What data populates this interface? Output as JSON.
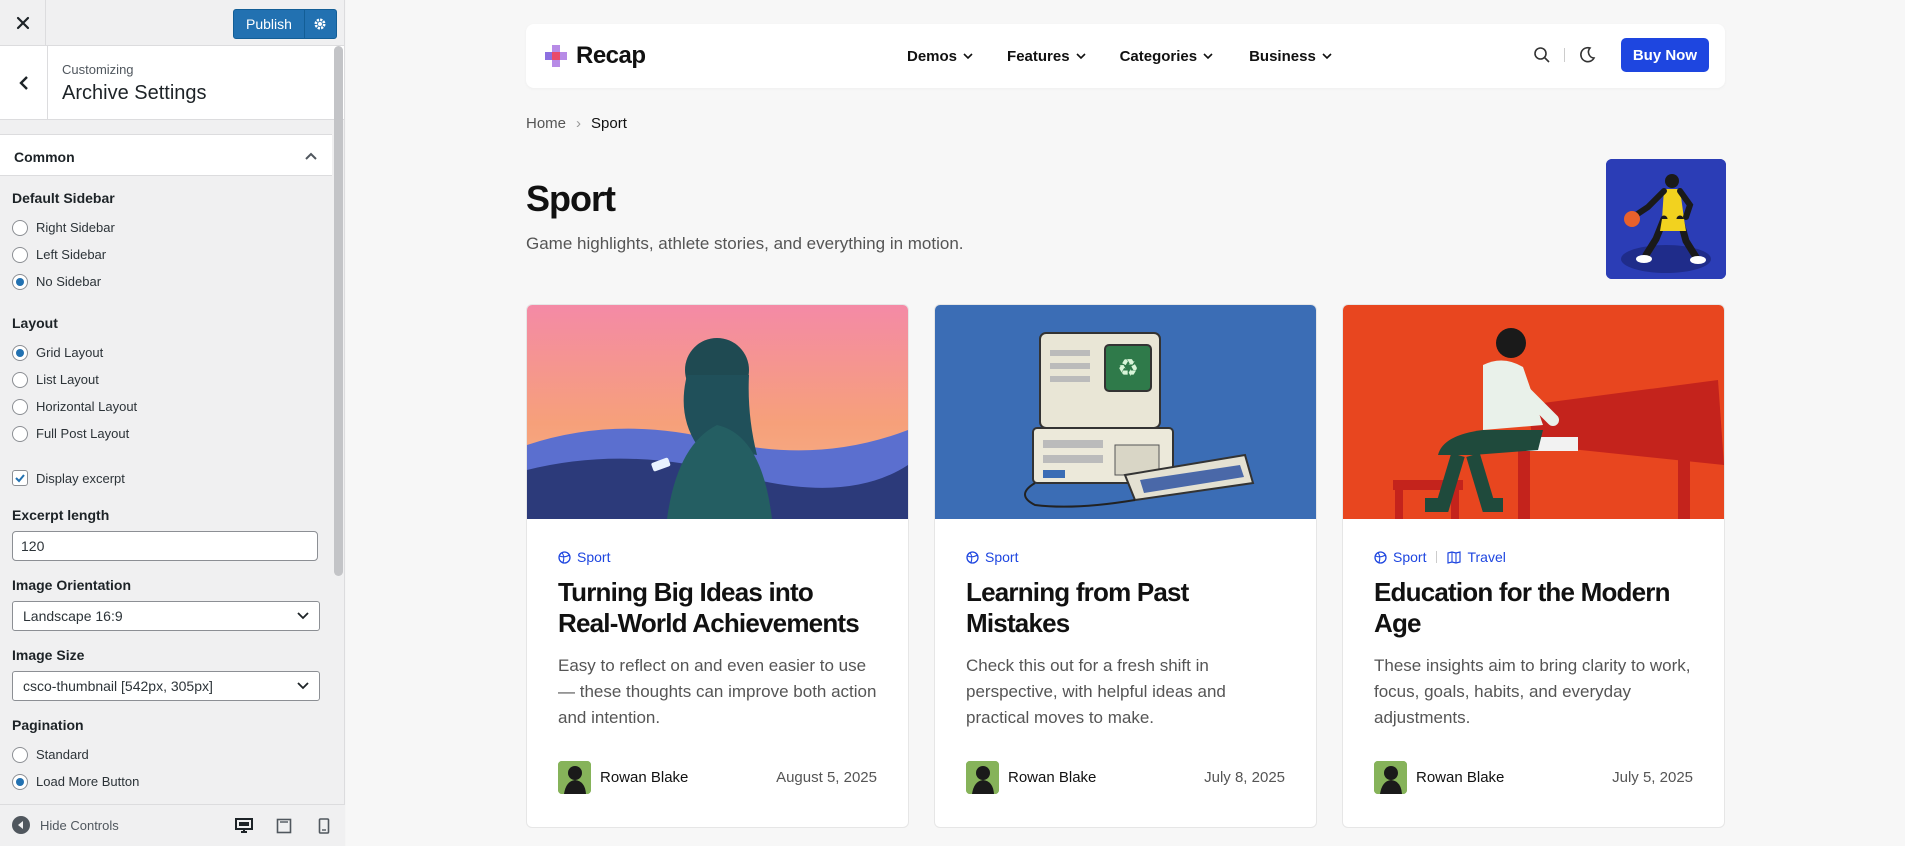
{
  "customizer": {
    "publish_label": "Publish",
    "customizing_label": "Customizing",
    "section_title": "Archive Settings",
    "group_label": "Common",
    "default_sidebar": {
      "label": "Default Sidebar",
      "options": [
        "Right Sidebar",
        "Left Sidebar",
        "No Sidebar"
      ],
      "selected": "No Sidebar"
    },
    "layout": {
      "label": "Layout",
      "options": [
        "Grid Layout",
        "List Layout",
        "Horizontal Layout",
        "Full Post Layout"
      ],
      "selected": "Grid Layout"
    },
    "display_excerpt": {
      "label": "Display excerpt",
      "checked": true
    },
    "excerpt_length": {
      "label": "Excerpt length",
      "value": "120"
    },
    "image_orientation": {
      "label": "Image Orientation",
      "value": "Landscape 16:9"
    },
    "image_size": {
      "label": "Image Size",
      "value": "csco-thumbnail [542px, 305px]"
    },
    "pagination": {
      "label": "Pagination",
      "options": [
        "Standard",
        "Load More Button"
      ],
      "selected": "Load More Button"
    },
    "hide_controls_label": "Hide Controls",
    "accent_color": "#2271b1"
  },
  "site": {
    "logo_text": "Recap",
    "nav": [
      "Demos",
      "Features",
      "Categories",
      "Business"
    ],
    "buy_label": "Buy Now",
    "accent_color": "#1e46e0",
    "breadcrumb": {
      "home": "Home",
      "current": "Sport"
    },
    "archive": {
      "title": "Sport",
      "description": "Game highlights, athlete stories, and everything in motion."
    },
    "posts": [
      {
        "categories": [
          "Sport"
        ],
        "title": "Turning Big Ideas into Real-World Achievements",
        "excerpt": "Easy to reflect on and even easier to use — these thoughts can improve both action and intention.",
        "author": "Rowan Blake",
        "date": "August 5, 2025"
      },
      {
        "categories": [
          "Sport"
        ],
        "title": "Learning from Past Mistakes",
        "excerpt": "Check this out for a fresh shift in perspective, with helpful ideas and practical moves to make.",
        "author": "Rowan Blake",
        "date": "July 8, 2025"
      },
      {
        "categories": [
          "Sport",
          "Travel"
        ],
        "title": "Education for the Modern Age",
        "excerpt": "These insights aim to bring clarity to work, focus, goals, habits, and everyday adjustments.",
        "author": "Rowan Blake",
        "date": "July 5, 2025"
      }
    ]
  }
}
